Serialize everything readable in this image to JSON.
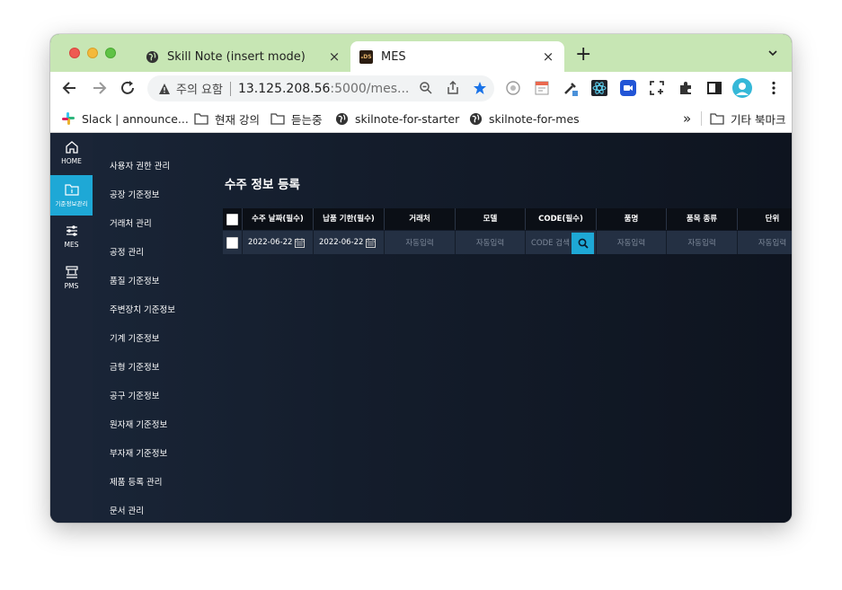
{
  "browser": {
    "tabs": [
      {
        "title": "Skill Note (insert mode)",
        "close": "×",
        "favicon": "globe-icon"
      },
      {
        "title": "MES",
        "close": "×",
        "favicon": "ds-logo-icon",
        "favicon_text": "ₒDS"
      }
    ],
    "new_tab": "+",
    "omnibox": {
      "warning": "주의 요함",
      "url_host": "13.125.208.56",
      "url_rest": ":5000/mes..."
    },
    "bookmarks": [
      {
        "label": "Slack | announce...",
        "icon": "slack-icon"
      },
      {
        "label": "현재 강의",
        "icon": "folder-icon"
      },
      {
        "label": "듣는중",
        "icon": "folder-icon"
      },
      {
        "label": "skilnote-for-starter",
        "icon": "globe-icon"
      },
      {
        "label": "skilnote-for-mes",
        "icon": "globe-icon"
      }
    ],
    "bookmarks_overflow": "»",
    "other_bookmarks": "기타 북마크"
  },
  "icon_nav": [
    {
      "label": "HOME",
      "icon": "home-icon"
    },
    {
      "label": "기준정보관리",
      "icon": "folder-info-icon",
      "active": true
    },
    {
      "label": "MES",
      "icon": "sliders-icon"
    },
    {
      "label": "PMS",
      "icon": "machine-icon"
    }
  ],
  "submenu": [
    "사용자 권한 관리",
    "공장 기준정보",
    "거래처 관리",
    "공정 관리",
    "품질 기준정보",
    "주변장치 기준정보",
    "기계 기준정보",
    "금형 기준정보",
    "공구 기준정보",
    "원자재 기준정보",
    "부자재 기준정보",
    "제품 등록 관리",
    "문서 관리"
  ],
  "page": {
    "title": "수주 정보 등록",
    "columns": [
      "수주 날짜(필수)",
      "납품 기한(필수)",
      "거래처",
      "모델",
      "CODE(필수)",
      "품명",
      "품목 종류",
      "단위"
    ],
    "row": {
      "order_date": "2022-06-22",
      "due_date": "2022-06-22",
      "customer": "자동입력",
      "model": "자동입력",
      "code_placeholder": "CODE 검색",
      "item_name": "자동입력",
      "item_type": "자동입력",
      "unit": "자동입력"
    }
  },
  "colors": {
    "accent": "#1ea8d6",
    "tab_strip": "#c7e6b4",
    "header": "#0b0f16",
    "row": "#243043"
  }
}
